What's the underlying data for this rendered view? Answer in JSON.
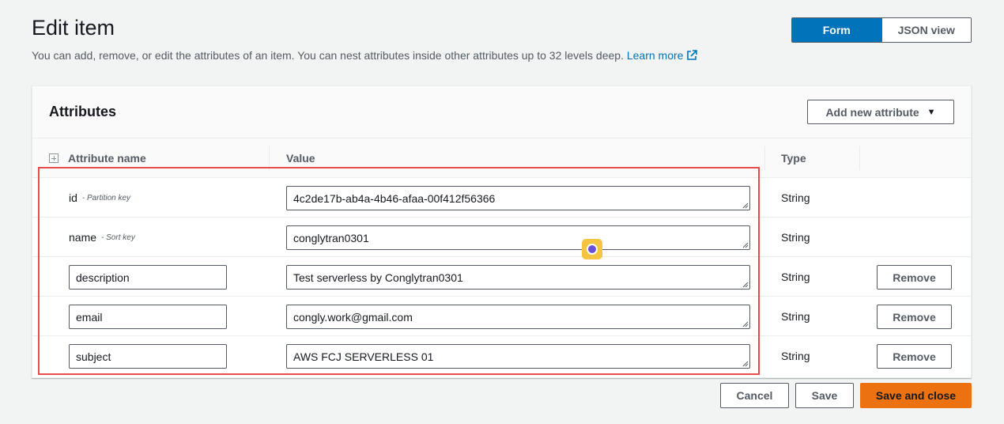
{
  "header": {
    "title": "Edit item",
    "description": "You can add, remove, or edit the attributes of an item. You can nest attributes inside other attributes up to 32 levels deep.",
    "learn_more": "Learn more"
  },
  "view_toggle": {
    "form_label": "Form",
    "json_label": "JSON view",
    "selected": "Form"
  },
  "attributes_panel": {
    "title": "Attributes",
    "add_button_label": "Add new attribute",
    "columns": {
      "name": "Attribute name",
      "value": "Value",
      "type": "Type"
    },
    "rows": [
      {
        "name": "id",
        "key_label": "- Partition key",
        "value": "4c2de17b-ab4a-4b46-afaa-00f412f56366",
        "type": "String",
        "editable_name": false
      },
      {
        "name": "name",
        "key_label": "- Sort key",
        "value": "conglytran0301",
        "type": "String",
        "editable_name": false
      },
      {
        "name": "description",
        "value": "Test serverless by Conglytran0301",
        "type": "String",
        "editable_name": true,
        "remove_label": "Remove"
      },
      {
        "name": "email",
        "value": "congly.work@gmail.com",
        "type": "String",
        "editable_name": true,
        "remove_label": "Remove"
      },
      {
        "name": "subject",
        "value": "AWS FCJ SERVERLESS 01",
        "type": "String",
        "editable_name": true,
        "remove_label": "Remove"
      }
    ]
  },
  "footer": {
    "cancel_label": "Cancel",
    "save_label": "Save",
    "save_close_label": "Save and close"
  },
  "colors": {
    "primary_blue": "#0073bb",
    "accent_orange": "#ec7211",
    "highlight_red": "#e74c4c"
  }
}
